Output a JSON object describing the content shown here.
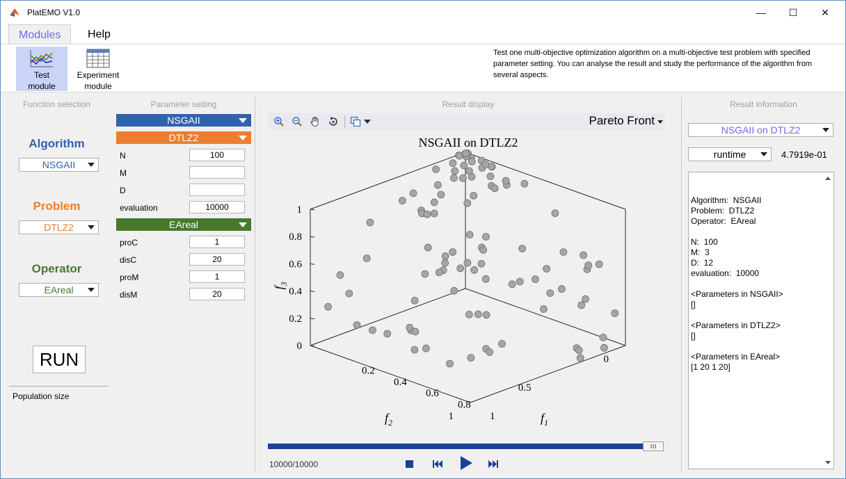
{
  "window": {
    "title": "PlatEMO V1.0",
    "minimize_glyph": "—",
    "maximize_glyph": "☐",
    "close_glyph": "✕"
  },
  "tabs": [
    {
      "label": "Modules",
      "active": true
    },
    {
      "label": "Help",
      "active": false
    }
  ],
  "ribbon": {
    "modules": [
      {
        "label_line1": "Test",
        "label_line2": "module",
        "icon": "line-chart-icon",
        "selected": true
      },
      {
        "label_line1": "Experiment",
        "label_line2": "module",
        "icon": "table-grid-icon",
        "selected": false
      }
    ],
    "description": "Test one multi-objective optimization algorithm on a multi-objective test problem with specified parameter setting. You can analyse the result and study the performance of the algorithm from several aspects."
  },
  "function_selection": {
    "title": "Function selection",
    "algorithm_label": "Algorithm",
    "algorithm_value": "NSGAII",
    "problem_label": "Problem",
    "problem_value": "DTLZ2",
    "operator_label": "Operator",
    "operator_value": "EAreal",
    "run_label": "RUN",
    "population_label": "Population size",
    "colors": {
      "algorithm": "#2f63ae",
      "problem": "#ec7e31",
      "operator": "#46792c"
    }
  },
  "parameter_setting": {
    "title": "Parameter setting",
    "algorithm_bar": "NSGAII",
    "problem_bar": "DTLZ2",
    "operator_bar": "EAreal",
    "problem_params": [
      {
        "label": "N",
        "value": "100"
      },
      {
        "label": "M",
        "value": ""
      },
      {
        "label": "D",
        "value": ""
      },
      {
        "label": "evaluation",
        "value": "10000"
      }
    ],
    "operator_params": [
      {
        "label": "proC",
        "value": "1"
      },
      {
        "label": "disC",
        "value": "20"
      },
      {
        "label": "proM",
        "value": "1"
      },
      {
        "label": "disM",
        "value": "20"
      }
    ]
  },
  "result_display": {
    "title": "Result display",
    "view_select": "Pareto Front",
    "tools": [
      "zoom-in-icon",
      "zoom-out-icon",
      "pan-hand-icon",
      "rotate-icon",
      "copy-figure-icon"
    ],
    "progress_text": "10000/10000",
    "progress_fraction": 1.0
  },
  "chart_data": {
    "type": "scatter",
    "title": "NSGAII on DTLZ2",
    "xlabel": "f",
    "xlabel_sub": "1",
    "ylabel": "f",
    "ylabel_sub": "2",
    "zlabel": "f",
    "zlabel_sub": "3",
    "z_ticks": [
      "0",
      "0.2",
      "0.4",
      "0.6",
      "0.8",
      "1"
    ],
    "x_ticks": [
      "0.2",
      "0.4",
      "0.6",
      "0.8",
      "1"
    ],
    "y_ticks": [
      "0",
      "0.5",
      "1"
    ],
    "xlim": [
      0,
      1
    ],
    "ylim": [
      0,
      1
    ],
    "zlim": [
      0,
      1
    ],
    "marker_color": "#a6a6a6"
  },
  "result_information": {
    "title": "Result information",
    "run_select": "NSGAII on DTLZ2",
    "metric_select": "runtime",
    "metric_value": "4.7919e-01",
    "log": "Algorithm:  NSGAII\nProblem:  DTLZ2\nOperator:  EAreal\n\nN:  100\nM:  3\nD:  12\nevaluation:  10000\n\n<Parameters in NSGAII>\n[]\n\n<Parameters in DTLZ2>\n[]\n\n<Parameters in EAreal>\n[1 20 1 20]"
  }
}
